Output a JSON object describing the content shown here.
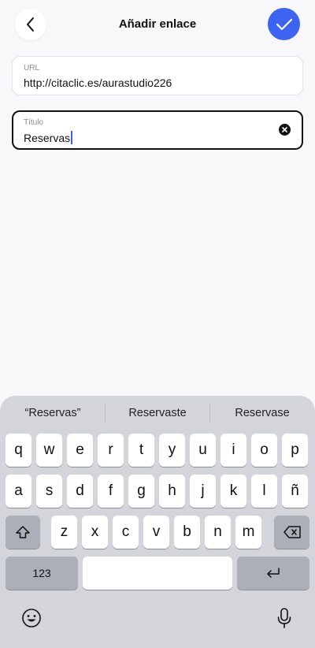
{
  "header": {
    "title": "Añadir enlace",
    "back_icon": "chevron-left-icon",
    "confirm_icon": "checkmark-icon"
  },
  "form": {
    "url": {
      "label": "URL",
      "value": "http://citaclic.es/aurastudio226"
    },
    "title": {
      "label": "Título",
      "value": "Reservas",
      "clear_icon": "clear-x-icon"
    }
  },
  "keyboard": {
    "suggestions": [
      "“Reservas”",
      "Reservaste",
      "Reservase"
    ],
    "row1": [
      "q",
      "w",
      "e",
      "r",
      "t",
      "y",
      "u",
      "i",
      "o",
      "p"
    ],
    "row2": [
      "a",
      "s",
      "d",
      "f",
      "g",
      "h",
      "j",
      "k",
      "l",
      "ñ"
    ],
    "row3": [
      "z",
      "x",
      "c",
      "v",
      "b",
      "n",
      "m"
    ],
    "numbers_key": "123",
    "icons": {
      "shift": "shift-icon",
      "backspace": "backspace-icon",
      "return": "return-icon",
      "emoji": "emoji-icon",
      "mic": "microphone-icon"
    }
  },
  "colors": {
    "accent": "#3c64f0",
    "background": "#f8f8fa",
    "keyboard_bg": "#d3d5db"
  }
}
